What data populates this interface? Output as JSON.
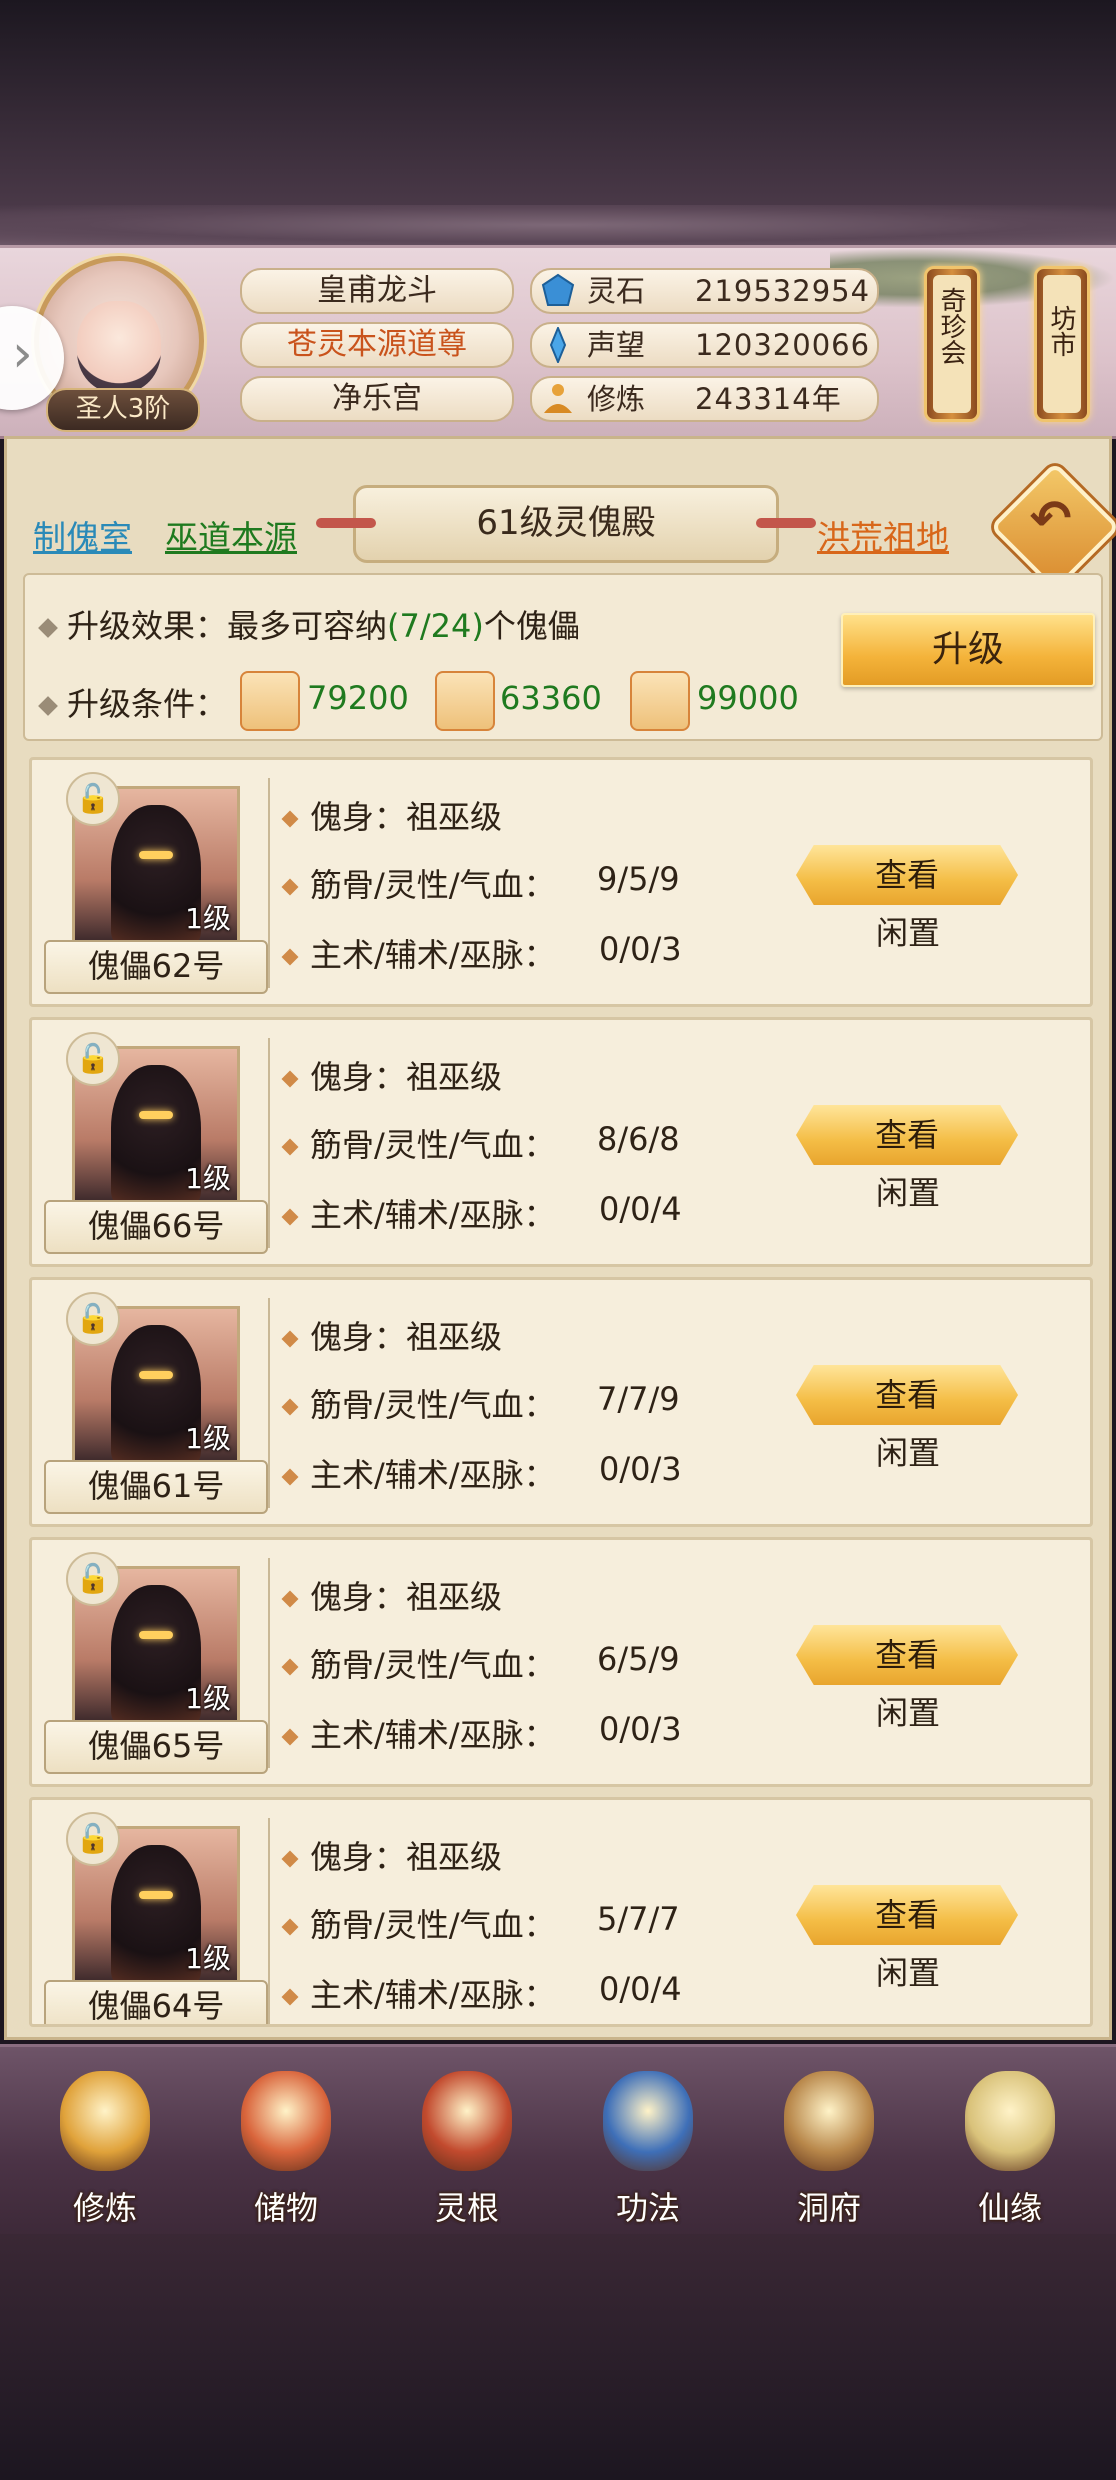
{
  "player": {
    "rank": "圣人3阶",
    "name": "皇甫龙斗",
    "title": "苍灵本源道尊",
    "sect": "净乐宫"
  },
  "resources": [
    {
      "name": "灵石",
      "value": "219532954",
      "icon": "spirit-stone-icon"
    },
    {
      "name": "声望",
      "value": "120320066",
      "icon": "prestige-crystal-icon"
    },
    {
      "name": "修炼",
      "value": "243314年",
      "icon": "meditation-icon"
    }
  ],
  "side_buttons": {
    "treasure": "奇珍会",
    "market": "坊市"
  },
  "page": {
    "title": "61级灵傀殿",
    "links": {
      "workshop": "制傀室",
      "wu_source": "巫道本源",
      "ancestral": "洪荒祖地"
    }
  },
  "upgrade": {
    "effect_label": "升级效果：",
    "effect_text": "最多可容纳",
    "effect_count": "(7/24)",
    "effect_suffix": "个傀儡",
    "cond_label": "升级条件：",
    "materials": [
      {
        "icon": "wood-material-icon",
        "value": "79200"
      },
      {
        "icon": "book-material-icon",
        "value": "63360"
      },
      {
        "icon": "herb-material-icon",
        "value": "99000"
      }
    ],
    "button": "升级"
  },
  "labels": {
    "body": "傀身：",
    "stats": "筋骨/灵性/气血：",
    "skills": "主术/辅术/巫脉：",
    "view": "查看"
  },
  "puppets": [
    {
      "name": "傀儡62号",
      "level": "1级",
      "body": "祖巫级",
      "stats": "9/5/9",
      "skills": "0/0/3",
      "status": "闲置"
    },
    {
      "name": "傀儡66号",
      "level": "1级",
      "body": "祖巫级",
      "stats": "8/6/8",
      "skills": "0/0/4",
      "status": "闲置"
    },
    {
      "name": "傀儡61号",
      "level": "1级",
      "body": "祖巫级",
      "stats": "7/7/9",
      "skills": "0/0/3",
      "status": "闲置"
    },
    {
      "name": "傀儡65号",
      "level": "1级",
      "body": "祖巫级",
      "stats": "6/5/9",
      "skills": "0/0/3",
      "status": "闲置"
    },
    {
      "name": "傀儡64号",
      "level": "1级",
      "body": "祖巫级",
      "stats": "5/7/7",
      "skills": "0/0/4",
      "status": "闲置"
    }
  ],
  "bottom_nav": [
    {
      "label": "修炼",
      "icon": "cultivation-monk-icon"
    },
    {
      "label": "储物",
      "icon": "storage-bag-icon"
    },
    {
      "label": "灵根",
      "icon": "spirit-root-icon"
    },
    {
      "label": "功法",
      "icon": "technique-book-icon"
    },
    {
      "label": "洞府",
      "icon": "cave-mansion-icon"
    },
    {
      "label": "仙缘",
      "icon": "immortal-gourd-icon"
    }
  ]
}
